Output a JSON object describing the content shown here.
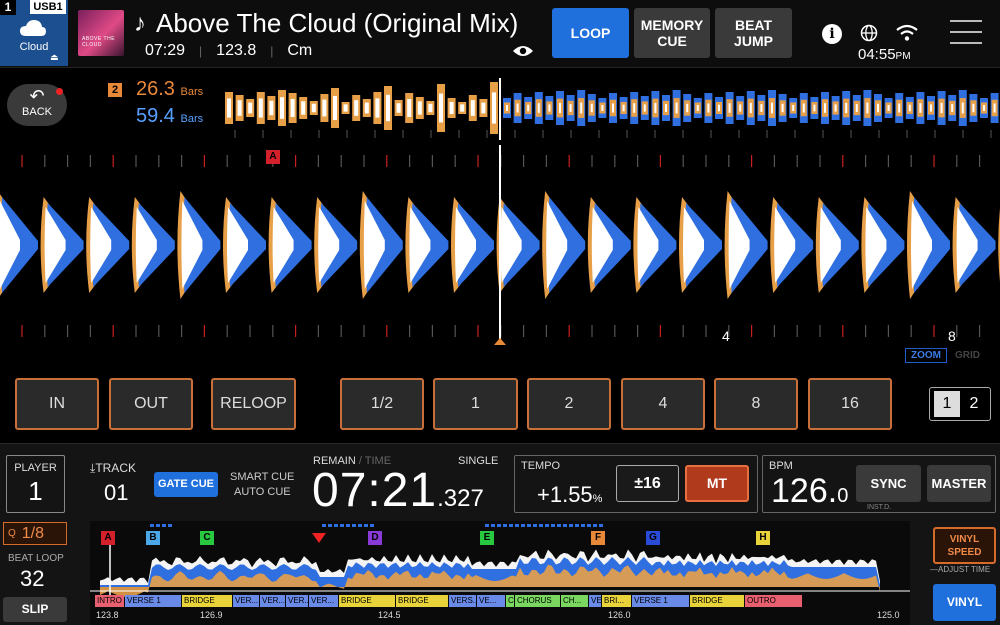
{
  "deck": {
    "number": "1",
    "media_label": "USB1",
    "source_label": "Cloud",
    "source_icon": "cloud-icon"
  },
  "track": {
    "title": "Above The Cloud (Original Mix)",
    "length": "07:29",
    "bpm": "123.8",
    "key": "Cm",
    "artwork_text": "ABOVE THE CLOUD"
  },
  "toolbar": {
    "loop_label": "LOOP",
    "memory_cue_label": "MEMORY CUE",
    "beat_jump_label": "BEAT JUMP"
  },
  "status": {
    "time": "04:55",
    "ampm": "PM"
  },
  "back": {
    "label": "BACK"
  },
  "bars": {
    "deck_badge": "2",
    "orange_value": "26.3",
    "blue_value": "59.4",
    "unit": "Bars"
  },
  "main_wave": {
    "cue_a": "A",
    "beat_4": "4",
    "beat_8": "8",
    "zoom_label": "ZOOM",
    "grid_label": "GRID"
  },
  "loop_buttons": {
    "in": "IN",
    "out": "OUT",
    "reloop": "RELOOP",
    "beats": [
      "1/2",
      "1",
      "2",
      "4",
      "8",
      "16"
    ],
    "pages": [
      "1",
      "2"
    ]
  },
  "player": {
    "label": "PLAYER",
    "number": "1"
  },
  "track_panel": {
    "label": "TRACK",
    "number": "01",
    "gate_cue": "GATE CUE",
    "smart_cue": "SMART CUE",
    "auto_cue": "AUTO CUE"
  },
  "time_panel": {
    "remain": "REMAIN",
    "time_sep": "/ TIME",
    "mode": "SINGLE",
    "time": "07:21",
    "ms": ".327"
  },
  "tempo": {
    "label": "TEMPO",
    "value": "+1.55",
    "unit": "%",
    "range": "±16",
    "mt": "MT"
  },
  "bpm_panel": {
    "label": "BPM",
    "value": "126.",
    "decimal": "0",
    "sync": "SYNC",
    "inst": "INST.D.",
    "master": "MASTER"
  },
  "left_controls": {
    "quantize": "1/8",
    "beat_loop_label": "BEAT LOOP",
    "beat_loop_value": "32",
    "slip": "SLIP"
  },
  "overview": {
    "cues": [
      {
        "label": "A",
        "color": "#d4202a"
      },
      {
        "label": "B",
        "color": "#4aa8e8"
      },
      {
        "label": "C",
        "color": "#28c840"
      },
      {
        "label": "D",
        "color": "#8a3ad8"
      },
      {
        "label": "E",
        "color": "#28c840"
      },
      {
        "label": "F",
        "color": "#e8893a"
      },
      {
        "label": "G",
        "color": "#2a4ad8"
      },
      {
        "label": "H",
        "color": "#e8d43a"
      }
    ],
    "phrases": [
      {
        "label": "INTRO",
        "color": "#e86070"
      },
      {
        "label": "VERSE 1",
        "color": "#6a8ae8"
      },
      {
        "label": "BRIDGE",
        "color": "#e8d43a"
      },
      {
        "label": "VER...",
        "color": "#6a8ae8"
      },
      {
        "label": "VER...",
        "color": "#6a8ae8"
      },
      {
        "label": "VER...",
        "color": "#6a8ae8"
      },
      {
        "label": "VER...",
        "color": "#6a8ae8"
      },
      {
        "label": "BRIDGE",
        "color": "#e8d43a"
      },
      {
        "label": "BRIDGE",
        "color": "#e8d43a"
      },
      {
        "label": "VERS...",
        "color": "#6a8ae8"
      },
      {
        "label": "VE...",
        "color": "#6a8ae8"
      },
      {
        "label": "C",
        "color": "#7ad860"
      },
      {
        "label": "CHORUS",
        "color": "#7ad860"
      },
      {
        "label": "CH...",
        "color": "#7ad860"
      },
      {
        "label": "VE",
        "color": "#6a8ae8"
      },
      {
        "label": "BRI...",
        "color": "#e8d43a"
      },
      {
        "label": "VERSE 1",
        "color": "#6a8ae8"
      },
      {
        "label": "BRIDGE",
        "color": "#e8d43a"
      },
      {
        "label": "OUTRO",
        "color": "#e86070"
      }
    ],
    "bpm_marks": [
      "123.8",
      "126.9",
      "124.5",
      "126.0",
      "125.0"
    ]
  },
  "right_controls": {
    "vinyl_speed": "VINYL SPEED",
    "adjust_time": "ADJUST TIME",
    "vinyl": "VINYL"
  }
}
